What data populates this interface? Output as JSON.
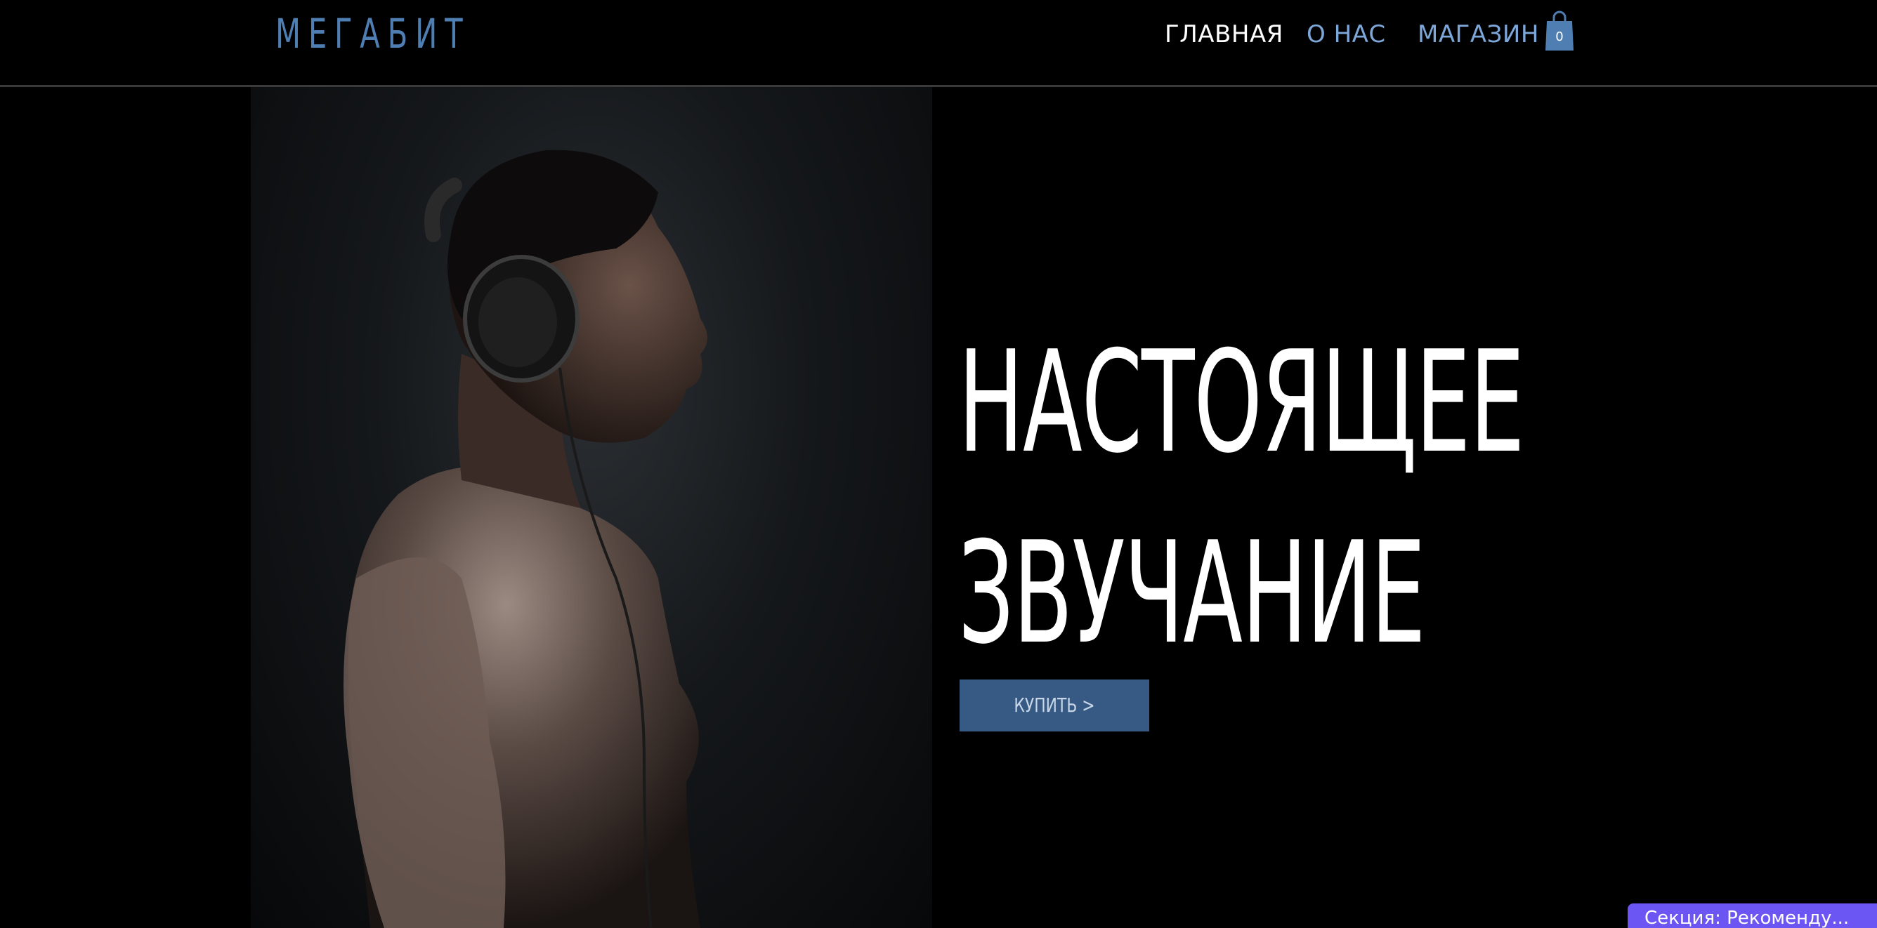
{
  "header": {
    "logo": "МЕГАБИТ",
    "nav": [
      {
        "label": "ГЛАВНАЯ",
        "active": true
      },
      {
        "label": "О НАС",
        "active": false
      },
      {
        "label": "МАГАЗИН",
        "active": false
      }
    ],
    "cart": {
      "count": "0",
      "icon": "shopping-bag-icon"
    }
  },
  "hero": {
    "title_line1": "НАСТОЯЩЕЕ",
    "title_line2": "ЗВУЧАНИЕ",
    "button_label": "КУПИТЬ >",
    "image": "man-with-headphones-photo"
  },
  "editor": {
    "section_tag": "Секция: Рекоменду..."
  },
  "colors": {
    "background": "#000000",
    "logo": "#4f7eb3",
    "nav_link": "#7ea7d9",
    "nav_active": "#ffffff",
    "button_bg": "#365a83",
    "section_tag_bg": "#6b55f3"
  }
}
